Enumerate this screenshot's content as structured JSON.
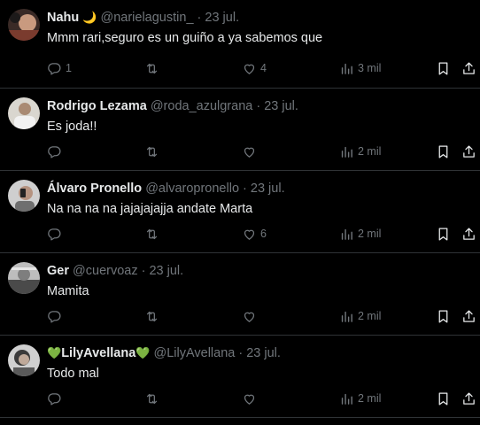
{
  "tweets": [
    {
      "name": "Nahu",
      "emoji": "🌙",
      "emoji_before": "",
      "handle": "@narielagustin_",
      "date": "· 23 jul.",
      "text": "Mmm rari,seguro es un guiño a ya sabemos que",
      "replies": "1",
      "retweets": "",
      "likes": "4",
      "views": "3 mil"
    },
    {
      "name": "Rodrigo Lezama",
      "emoji": "",
      "emoji_before": "",
      "handle": "@roda_azulgrana",
      "date": "· 23 jul.",
      "text": "Es joda!!",
      "replies": "",
      "retweets": "",
      "likes": "",
      "views": "2 mil"
    },
    {
      "name": "Álvaro Pronello",
      "emoji": "",
      "emoji_before": "",
      "handle": "@alvaropronello",
      "date": "· 23 jul.",
      "text": "Na na na na jajajajajja andate Marta",
      "replies": "",
      "retweets": "",
      "likes": "6",
      "views": "2 mil"
    },
    {
      "name": "Ger",
      "emoji": "",
      "emoji_before": "",
      "handle": "@cuervoaz",
      "date": "· 23 jul.",
      "text": "Mamita",
      "replies": "",
      "retweets": "",
      "likes": "",
      "views": "2 mil"
    },
    {
      "name": "LilyAvellana",
      "emoji": "💚",
      "emoji_before": "💚",
      "handle": "@LilyAvellana",
      "date": "· 23 jul.",
      "text": "Todo mal",
      "replies": "",
      "retweets": "",
      "likes": "",
      "views": "2 mil"
    }
  ],
  "icons": {
    "reply": "reply-icon",
    "retweet": "retweet-icon",
    "like": "heart-icon",
    "views": "views-icon",
    "bookmark": "bookmark-icon",
    "share": "share-icon"
  },
  "colors": {
    "background": "#000000",
    "text": "#e7e9ea",
    "muted": "#71767b",
    "divider": "#2f3336"
  }
}
